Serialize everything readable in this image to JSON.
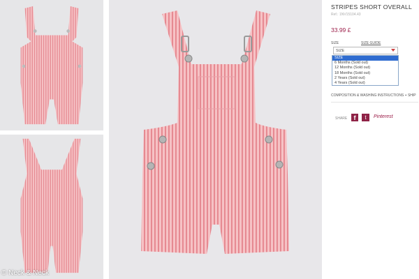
{
  "watermark": "© Neck & Neck",
  "images": {
    "garment_fill": "#f3b3b8",
    "stripe_color": "#e8878f",
    "button_color": "#b9b9b9"
  },
  "product": {
    "title": "STRIPES SHORT OVERALL",
    "ref": "Ref.: 1NV15104.43",
    "price": "33.99 £",
    "size_label": "SIZE",
    "size_guide": "SIZE GUIDE",
    "select_value": "SIZE",
    "size_options": [
      "SIZE",
      "6 Months (Sold out)",
      "12 Months (Sold out)",
      "18 Months (Sold out)",
      "2 Years (Sold out)",
      "4 Years (Sold out)"
    ],
    "composition": "COMPOSITION & WASHING INSTRUCTIONS +",
    "composition_extra": "SHIP"
  },
  "share": {
    "label": "SHARE",
    "facebook_glyph": "f",
    "twitter_glyph": "t",
    "pinterest_label": "Pinterest"
  },
  "accent_color": "#9b1d48",
  "selected_option_color": "#2f6cd0"
}
